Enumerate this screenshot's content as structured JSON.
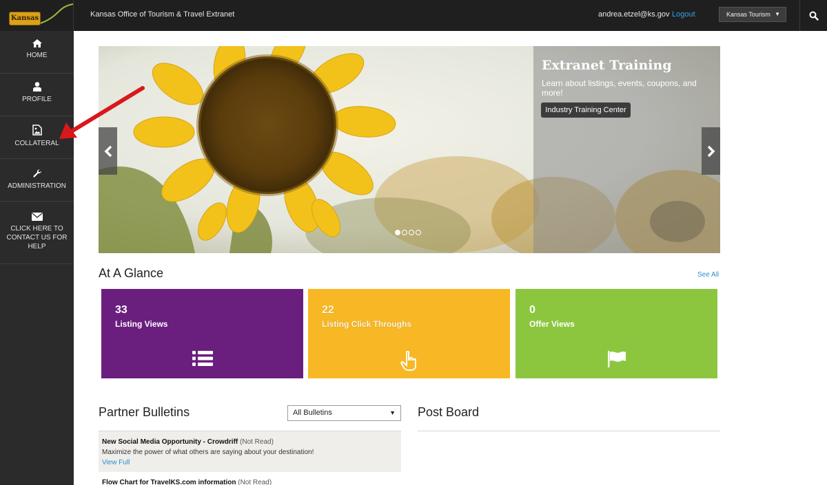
{
  "header": {
    "logo_text": "Kansas",
    "title": "Kansas Office of Tourism & Travel Extranet",
    "user_email": "andrea.etzel@ks.gov",
    "logout_label": "Logout",
    "account_selected": "Kansas Tourism"
  },
  "sidebar": {
    "items": [
      {
        "label": "HOME",
        "icon": "home-icon"
      },
      {
        "label": "PROFILE",
        "icon": "user-icon"
      },
      {
        "label": "COLLATERAL",
        "icon": "image-icon"
      },
      {
        "label": "ADMINISTRATION",
        "icon": "wrench-icon"
      },
      {
        "label": "CLICK HERE TO CONTACT US FOR HELP",
        "icon": "envelope-icon"
      }
    ]
  },
  "hero": {
    "panel_title": "Extranet Training",
    "panel_text": "Learn about listings, events, coupons, and more!",
    "panel_button": "Industry Training Center",
    "slide_count": 4,
    "active_slide": 1
  },
  "glance": {
    "title": "At A Glance",
    "see_all": "See All",
    "tiles": [
      {
        "value": "33",
        "label": "Listing Views",
        "color": "#6a1f7e",
        "icon": "list-icon"
      },
      {
        "value": "22",
        "label": "Listing Click Throughs",
        "color": "#f8b724",
        "icon": "pointer-hand-icon"
      },
      {
        "value": "0",
        "label": "Offer Views",
        "color": "#8cc63f",
        "icon": "flag-icon"
      }
    ]
  },
  "bulletins": {
    "title": "Partner Bulletins",
    "filter_selected": "All Bulletins",
    "items": [
      {
        "title": "New Social Media Opportunity - Crowdriff",
        "status": "(Not Read)",
        "description": "Maximize the power of what others are saying about your destination!",
        "link": "View Full"
      },
      {
        "title": "Flow Chart for TravelKS.com information",
        "status": "(Not Read)",
        "description": "",
        "link": ""
      }
    ]
  },
  "postboard": {
    "title": "Post Board"
  }
}
